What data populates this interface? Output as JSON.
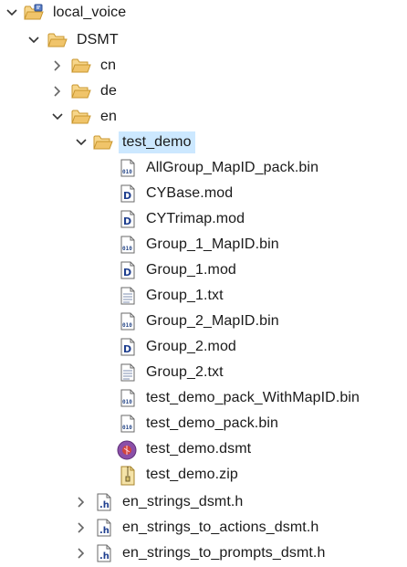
{
  "tree": {
    "items": [
      {
        "label": "local_voice",
        "icon": "project-folder-icon",
        "expanded": true
      },
      {
        "label": "DSMT",
        "icon": "folder-open-icon",
        "expanded": true
      },
      {
        "label": "cn",
        "icon": "folder-icon",
        "expanded": false
      },
      {
        "label": "de",
        "icon": "folder-icon",
        "expanded": false
      },
      {
        "label": "en",
        "icon": "folder-open-icon",
        "expanded": true
      },
      {
        "label": "test_demo",
        "icon": "folder-open-icon",
        "expanded": true,
        "selected": true
      },
      {
        "label": "AllGroup_MapID_pack.bin",
        "icon": "binary-file-icon"
      },
      {
        "label": "CYBase.mod",
        "icon": "mod-file-icon"
      },
      {
        "label": "CYTrimap.mod",
        "icon": "mod-file-icon"
      },
      {
        "label": "Group_1_MapID.bin",
        "icon": "binary-file-icon"
      },
      {
        "label": "Group_1.mod",
        "icon": "mod-file-icon"
      },
      {
        "label": "Group_1.txt",
        "icon": "text-file-icon"
      },
      {
        "label": "Group_2_MapID.bin",
        "icon": "binary-file-icon"
      },
      {
        "label": "Group_2.mod",
        "icon": "mod-file-icon"
      },
      {
        "label": "Group_2.txt",
        "icon": "text-file-icon"
      },
      {
        "label": "test_demo_pack_WithMapID.bin",
        "icon": "binary-file-icon"
      },
      {
        "label": "test_demo_pack.bin",
        "icon": "binary-file-icon"
      },
      {
        "label": "test_demo.dsmt",
        "icon": "dsmt-file-icon"
      },
      {
        "label": "test_demo.zip",
        "icon": "zip-file-icon"
      },
      {
        "label": "en_strings_dsmt.h",
        "icon": "header-file-icon",
        "expanded": false
      },
      {
        "label": "en_strings_to_actions_dsmt.h",
        "icon": "header-file-icon",
        "expanded": false
      },
      {
        "label": "en_strings_to_prompts_dsmt.h",
        "icon": "header-file-icon",
        "expanded": false
      }
    ]
  },
  "colors": {
    "selection": "#cce8ff",
    "folder": "#f0c46a",
    "folder_dark": "#c8962e",
    "bin_text": "#2a4a8a",
    "mod_letter": "#1f3f8f",
    "dsmt_purple": "#8b4fa8",
    "dsmt_red": "#d2453c"
  }
}
